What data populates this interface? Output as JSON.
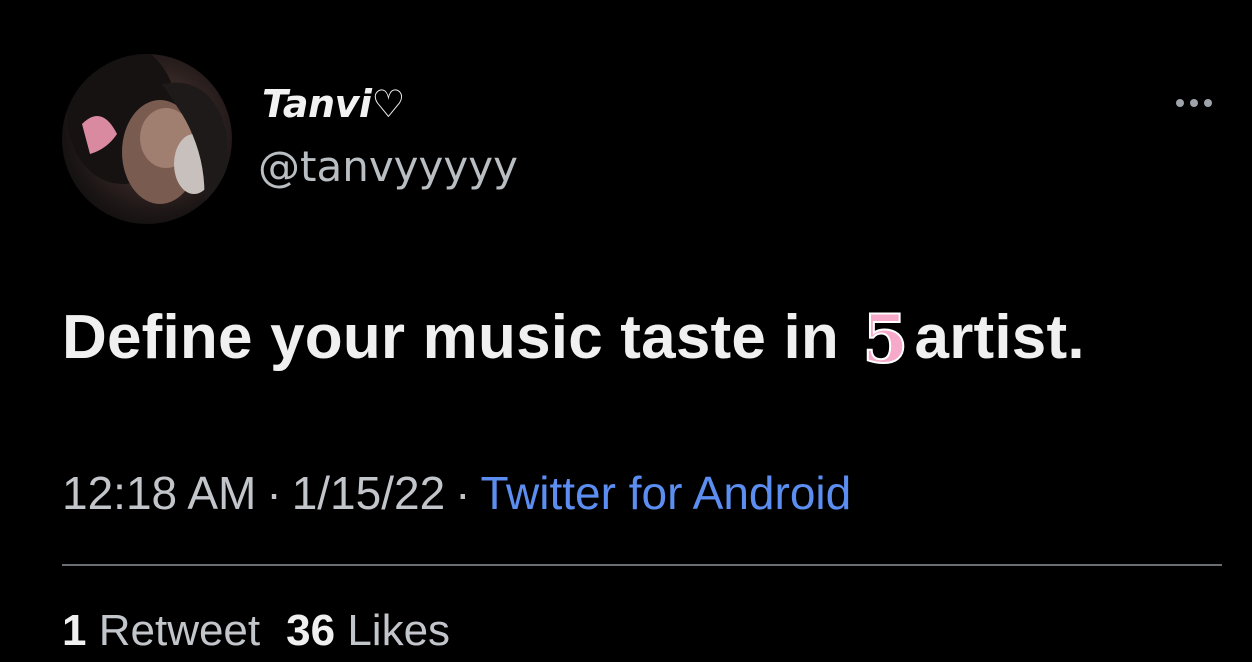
{
  "tweet": {
    "author": {
      "display_name": "Tanvi♡",
      "handle": "@tanvyyyyy",
      "avatar_icon": "profile-photo"
    },
    "more_icon": "more-options-icon",
    "text_before": "Define your music taste in ",
    "text_number": "5",
    "text_after": "artist.",
    "time": "12:18 AM",
    "date": "1/15/22",
    "separator": "·",
    "source": "Twitter for Android",
    "retweets": {
      "count": "1",
      "label": "Retweet"
    },
    "likes": {
      "count": "36",
      "label": "Likes"
    }
  },
  "colors": {
    "background": "#000000",
    "source_link": "#5b8ef0",
    "number_accent": "#f6a9c8"
  }
}
